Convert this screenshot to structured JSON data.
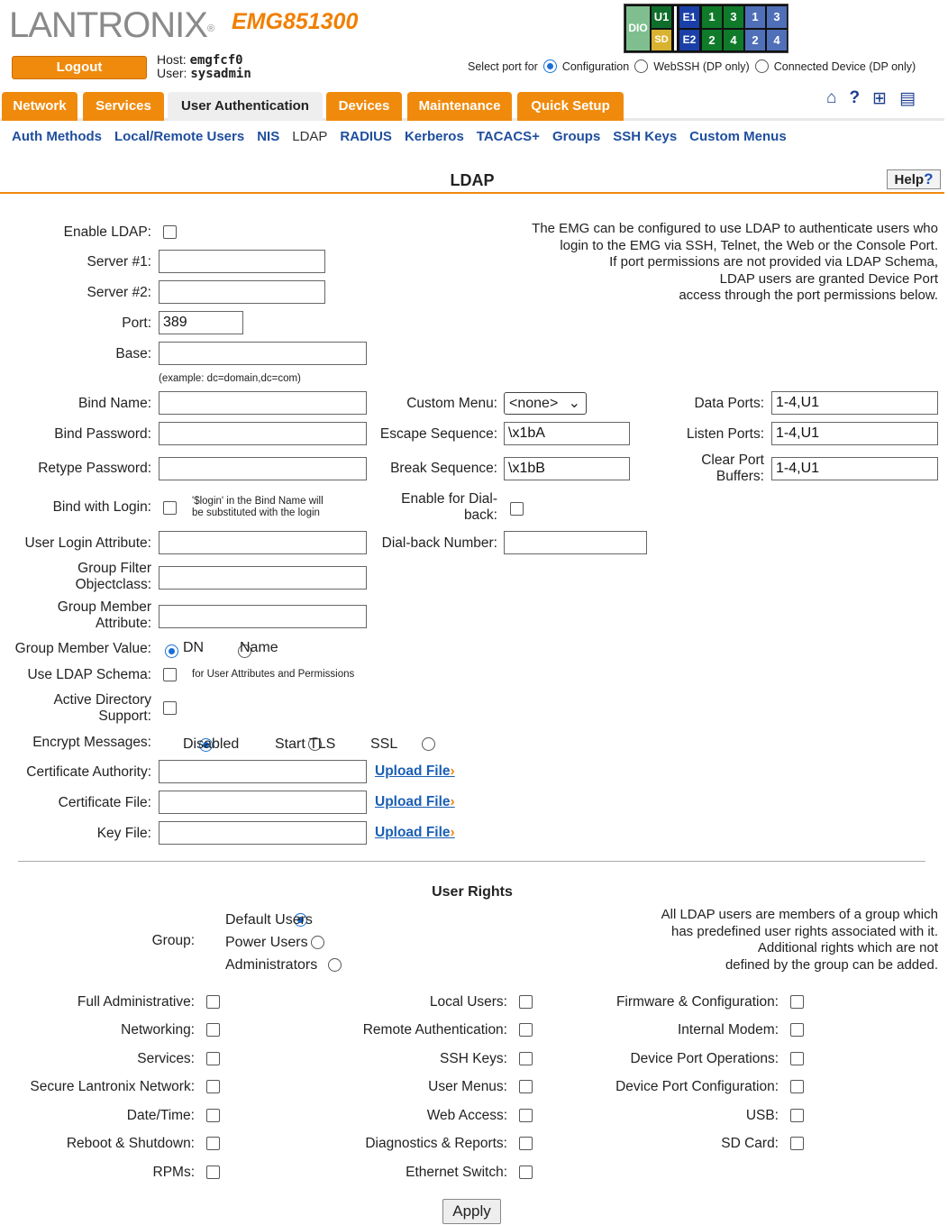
{
  "header": {
    "brand": "LANTRONIX",
    "registered": "®",
    "model": "EMG851300",
    "logout_label": "Logout",
    "host_label": "Host:",
    "host_value": "emgfcf0",
    "user_label": "User:",
    "user_value": "sysadmin",
    "port_panel": {
      "dio": "DIO",
      "u1": "U1",
      "sd": "SD",
      "e1": "E1",
      "e2": "E2",
      "ports_top": [
        "1",
        "3",
        "1",
        "3"
      ],
      "ports_bottom": [
        "2",
        "4",
        "2",
        "4"
      ]
    },
    "select_port_label": "Select port for",
    "port_options": [
      "Configuration",
      "WebSSH (DP only)",
      "Connected Device (DP only)"
    ],
    "selected_port_option": "Configuration"
  },
  "tabs": [
    "Network",
    "Services",
    "User Authentication",
    "Devices",
    "Maintenance",
    "Quick Setup"
  ],
  "active_tab": "User Authentication",
  "icons": [
    "home-icon",
    "help-question-icon",
    "sitemap-icon",
    "log-list-icon"
  ],
  "subnav": [
    "Auth Methods",
    "Local/Remote Users",
    "NIS",
    "LDAP",
    "RADIUS",
    "Kerberos",
    "TACACS+",
    "Groups",
    "SSH Keys",
    "Custom Menus"
  ],
  "active_subnav": "LDAP",
  "page_title": "LDAP",
  "help_label": "Help",
  "help_mark": "?",
  "form": {
    "enable_ldap": "Enable LDAP:",
    "server1": "Server #1:",
    "server2": "Server #2:",
    "port": "Port:",
    "port_value": "389",
    "base": "Base:",
    "base_example": "(example: dc=domain,dc=com)",
    "bind_name": "Bind Name:",
    "bind_password": "Bind Password:",
    "retype_password": "Retype Password:",
    "bind_with_login": "Bind with Login:",
    "bind_with_login_note_1": "'$login' in the Bind Name will",
    "bind_with_login_note_2": "be substituted with the login",
    "user_login_attribute": "User Login Attribute:",
    "group_filter_1": "Group Filter",
    "group_filter_2": "Objectclass:",
    "group_member_attr_1": "Group Member",
    "group_member_attr_2": "Attribute:",
    "group_member_value": "Group Member Value:",
    "gmv_dn": "DN",
    "gmv_name": "Name",
    "use_ldap_schema": "Use LDAP Schema:",
    "use_ldap_schema_note": "for User Attributes and Permissions",
    "ad_support_1": "Active Directory",
    "ad_support_2": "Support:",
    "encrypt_messages": "Encrypt Messages:",
    "enc_disabled": "Disabled",
    "enc_starttls": "Start TLS",
    "enc_ssl": "SSL",
    "certificate_authority": "Certificate Authority:",
    "certificate_file": "Certificate File:",
    "key_file": "Key File:",
    "upload_file": "Upload File",
    "custom_menu": "Custom Menu:",
    "custom_menu_value": "<none>",
    "escape_sequence": "Escape Sequence:",
    "escape_sequence_value": "\\x1bA",
    "break_sequence": "Break Sequence:",
    "break_sequence_value": "\\x1bB",
    "dialback_1": "Enable for Dial-",
    "dialback_2": "back:",
    "dialback_number": "Dial-back Number:",
    "data_ports": "Data Ports:",
    "data_ports_value": "1-4,U1",
    "listen_ports": "Listen Ports:",
    "listen_ports_value": "1-4,U1",
    "clear_port_1": "Clear Port",
    "clear_port_2": "Buffers:",
    "clear_port_value": "1-4,U1"
  },
  "info_text": [
    "The EMG can be configured to use LDAP to authenticate users who",
    "login to the EMG via SSH, Telnet, the Web or the Console Port.",
    "If port permissions are not provided via LDAP Schema,",
    "LDAP users are granted Device Port",
    "access through the port permissions below."
  ],
  "user_rights": {
    "title": "User Rights",
    "group_label": "Group:",
    "groups": [
      "Default Users",
      "Power Users",
      "Administrators"
    ],
    "selected_group": "Default Users",
    "info": [
      "All LDAP users are members of a group which",
      "has predefined user rights associated with it.",
      "Additional rights which are not",
      "defined by the group can be added."
    ],
    "col1": [
      "Full Administrative:",
      "Networking:",
      "Services:",
      "Secure Lantronix Network:",
      "Date/Time:",
      "Reboot & Shutdown:",
      "RPMs:"
    ],
    "col2": [
      "Local Users:",
      "Remote Authentication:",
      "SSH Keys:",
      "User Menus:",
      "Web Access:",
      "Diagnostics & Reports:",
      "Ethernet Switch:"
    ],
    "col3": [
      "Firmware & Configuration:",
      "Internal Modem:",
      "Device Port Operations:",
      "Device Port Configuration:",
      "USB:",
      "SD Card:"
    ]
  },
  "apply_label": "Apply"
}
